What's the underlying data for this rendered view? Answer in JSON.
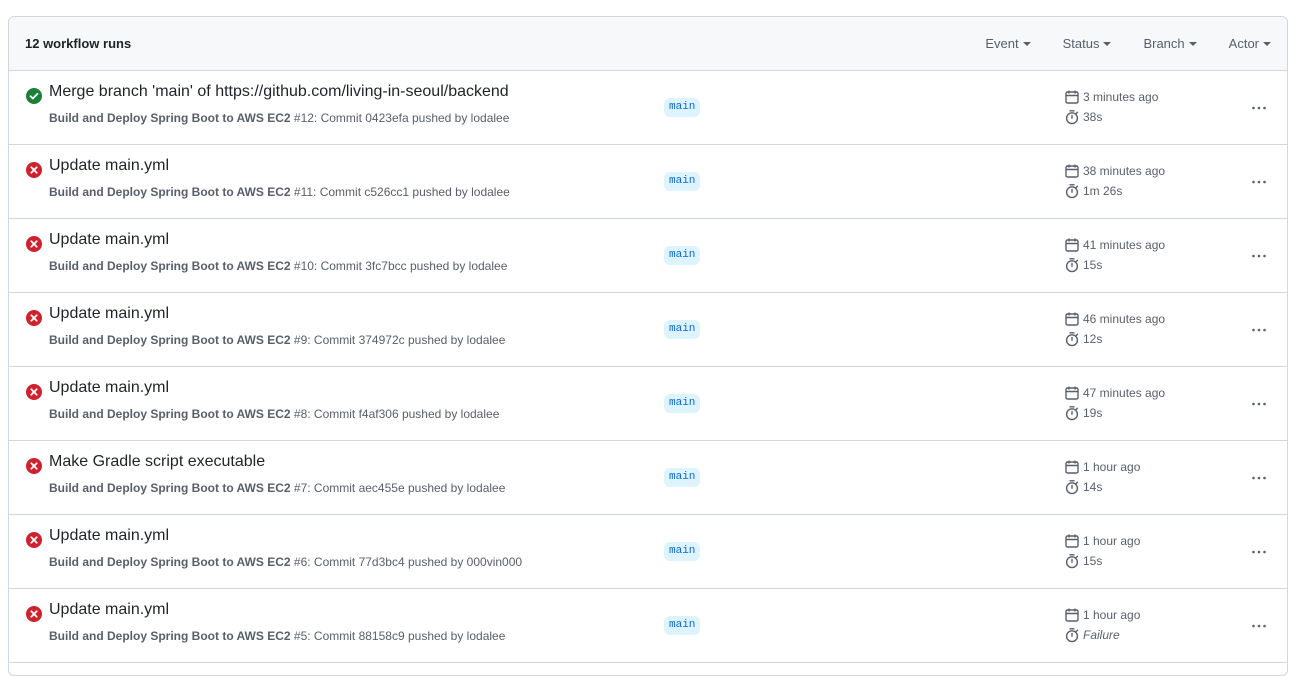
{
  "header": {
    "run_count": "12 workflow runs",
    "filters": [
      "Event",
      "Status",
      "Branch",
      "Actor"
    ]
  },
  "colors": {
    "success": "#1a7f37",
    "failure": "#cf222e",
    "branch_bg": "#ddf4ff",
    "branch_fg": "#0969da"
  },
  "runs": [
    {
      "status": "success",
      "title": "Merge branch 'main' of https://github.com/living-in-seoul/backend",
      "workflow": "Build and Deploy Spring Boot to AWS EC2",
      "detail": "#12: Commit 0423efa pushed by lodalee",
      "branch": "main",
      "time": "3 minutes ago",
      "duration": "38s"
    },
    {
      "status": "failure",
      "title": "Update main.yml",
      "workflow": "Build and Deploy Spring Boot to AWS EC2",
      "detail": "#11: Commit c526cc1 pushed by lodalee",
      "branch": "main",
      "time": "38 minutes ago",
      "duration": "1m 26s"
    },
    {
      "status": "failure",
      "title": "Update main.yml",
      "workflow": "Build and Deploy Spring Boot to AWS EC2",
      "detail": "#10: Commit 3fc7bcc pushed by lodalee",
      "branch": "main",
      "time": "41 minutes ago",
      "duration": "15s"
    },
    {
      "status": "failure",
      "title": "Update main.yml",
      "workflow": "Build and Deploy Spring Boot to AWS EC2",
      "detail": "#9: Commit 374972c pushed by lodalee",
      "branch": "main",
      "time": "46 minutes ago",
      "duration": "12s"
    },
    {
      "status": "failure",
      "title": "Update main.yml",
      "workflow": "Build and Deploy Spring Boot to AWS EC2",
      "detail": "#8: Commit f4af306 pushed by lodalee",
      "branch": "main",
      "time": "47 minutes ago",
      "duration": "19s"
    },
    {
      "status": "failure",
      "title": "Make Gradle script executable",
      "workflow": "Build and Deploy Spring Boot to AWS EC2",
      "detail": "#7: Commit aec455e pushed by lodalee",
      "branch": "main",
      "time": "1 hour ago",
      "duration": "14s"
    },
    {
      "status": "failure",
      "title": "Update main.yml",
      "workflow": "Build and Deploy Spring Boot to AWS EC2",
      "detail": "#6: Commit 77d3bc4 pushed by 000vin000",
      "branch": "main",
      "time": "1 hour ago",
      "duration": "15s"
    },
    {
      "status": "failure",
      "title": "Update main.yml",
      "workflow": "Build and Deploy Spring Boot to AWS EC2",
      "detail": "#5: Commit 88158c9 pushed by lodalee",
      "branch": "main",
      "time": "1 hour ago",
      "duration": "Failure"
    }
  ]
}
